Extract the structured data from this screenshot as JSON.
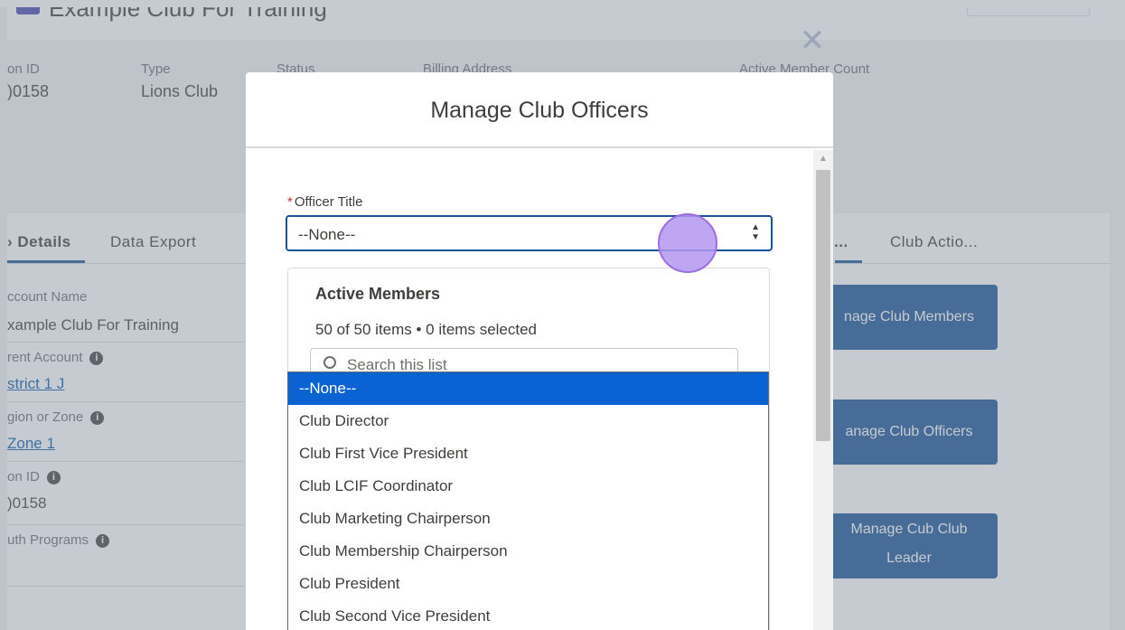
{
  "page": {
    "title": "Example Club For Training"
  },
  "highlights": [
    {
      "label": "on ID",
      "value": ")0158"
    },
    {
      "label": "Type",
      "value": "Lions Club"
    },
    {
      "label": "Status",
      "value": ""
    },
    {
      "label": "Billing Address",
      "value": ""
    },
    {
      "label": "Active Member Count",
      "value": ""
    }
  ],
  "tabs": [
    {
      "label": "› Details"
    },
    {
      "label": "Data Export"
    },
    {
      "label": "..."
    },
    {
      "label": "Club Actio..."
    }
  ],
  "details": [
    {
      "label": "ccount Name",
      "value": "xample Club For Training",
      "link": false,
      "info": false
    },
    {
      "label": "rent Account",
      "value": "strict 1 J",
      "link": true,
      "info": true
    },
    {
      "label": "gion or Zone",
      "value": "Zone 1",
      "link": true,
      "info": true
    },
    {
      "label": "on ID",
      "value": ")0158",
      "link": false,
      "info": true
    },
    {
      "label": "uth Programs",
      "value": "",
      "link": false,
      "info": true
    }
  ],
  "actions": [
    {
      "line1": "nage Club Members",
      "line2": ""
    },
    {
      "line1": "anage Club Officers",
      "line2": ""
    },
    {
      "line1": "Manage Cub Club",
      "line2": "Leader"
    }
  ],
  "modal": {
    "title": "Manage Club Officers",
    "close_glyph": "✕",
    "field_label": "Officer Title",
    "required_marker": "*",
    "selected_value": "--None--",
    "members_title": "Active Members",
    "members_count": "50 of 50 items • 0 items selected",
    "search_placeholder": "Search this list",
    "options": [
      "--None--",
      "Club Director",
      "Club First Vice President",
      "Club LCIF Coordinator",
      "Club Marketing Chairperson",
      "Club Membership Chairperson",
      "Club President",
      "Club Second Vice President"
    ]
  },
  "colors": {
    "brand_blue": "#1b5297",
    "option_highlight": "#0b63d3",
    "required_red": "#c23934"
  }
}
